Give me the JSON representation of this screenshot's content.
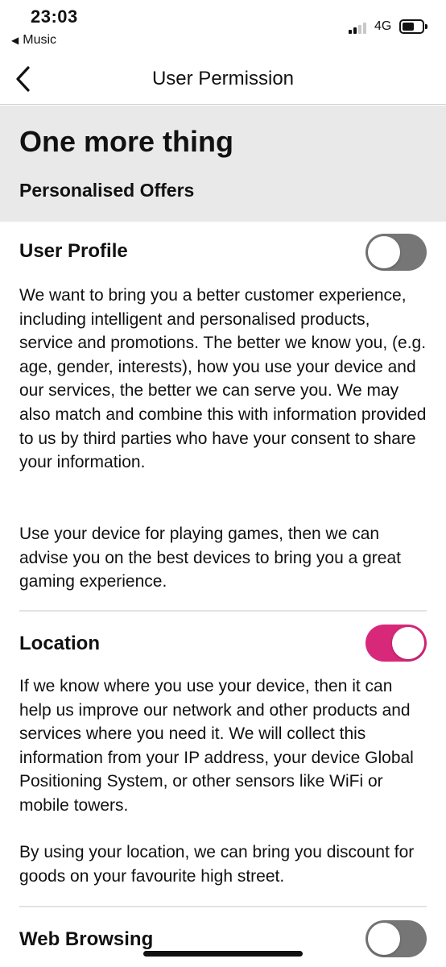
{
  "status_bar": {
    "time": "23:03",
    "back_app_label": "Music",
    "network": "4G",
    "signal_bars_active": 2,
    "signal_bars_total": 4,
    "battery_level": 0.45
  },
  "nav": {
    "title": "User Permission"
  },
  "header": {
    "title": "One more thing",
    "subtitle": "Personalised Offers"
  },
  "sections": [
    {
      "title": "User Profile",
      "toggle_on": false,
      "paragraphs": [
        "We want to bring you a better customer experience, including intelligent and personalised products, service and promotions. The better we know you, (e.g. age, gender, interests), how you use your device and our services, the better we can serve you. We may also match and combine this with information provided to us by third parties who have your consent to share your information.",
        "Use your device for playing games, then we can advise you on the best devices to bring you a great gaming experience."
      ]
    },
    {
      "title": "Location",
      "toggle_on": true,
      "paragraphs": [
        "If we know where you use your device, then it can help us improve our network and other products and services where you need it. We will collect this information from your IP address, your device Global Positioning System, or other sensors like WiFi or mobile towers.",
        "By using your location, we can bring you discount for goods on your favourite high street."
      ]
    },
    {
      "title": "Web Browsing",
      "toggle_on": false,
      "paragraphs": []
    }
  ],
  "colors": {
    "toggle_on": "#d8287a",
    "toggle_off": "#767676",
    "header_band": "#e9e9e9"
  },
  "icons": {
    "nav_back": "chevron-left-icon",
    "status_back": "back-triangle-icon"
  }
}
